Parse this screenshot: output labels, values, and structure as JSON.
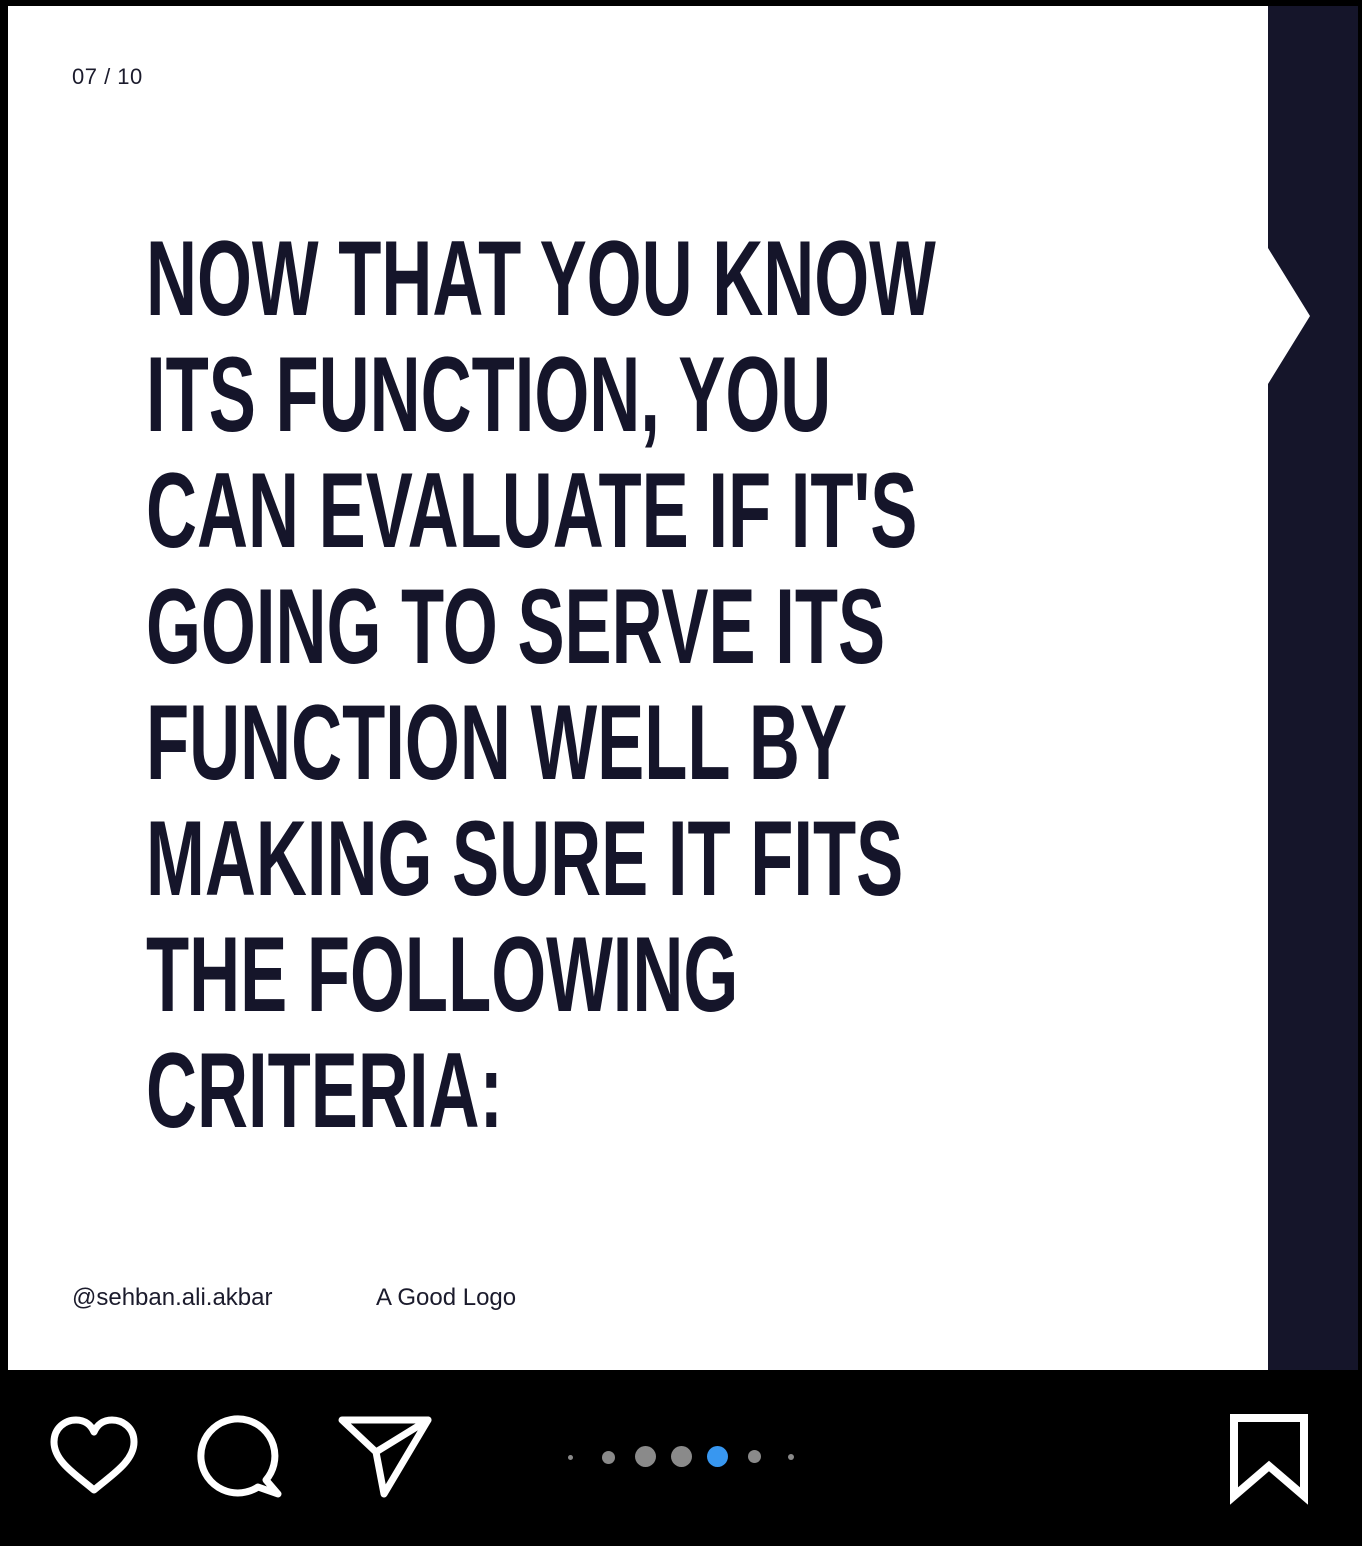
{
  "post": {
    "counter": "07 / 10",
    "headline_lines": [
      "NOW THAT YOU KNOW",
      "ITS FUNCTION, YOU",
      "CAN EVALUATE IF IT'S",
      "GOING TO SERVE ITS",
      "FUNCTION WELL BY",
      "MAKING SURE IT FITS",
      "THE FOLLOWING",
      "CRITERIA:"
    ],
    "handle": "@sehban.ali.akbar",
    "brand": "A Good Logo"
  },
  "colors": {
    "background": "#000000",
    "card": "#ffffff",
    "headline": "#15152a",
    "side_band": "#15152a",
    "active_dot": "#3897f0",
    "inactive_dot": "#8a8a8a"
  },
  "action_bar": {
    "icons": [
      "heart-icon",
      "comment-icon",
      "send-icon",
      "bookmark-icon"
    ],
    "carousel": {
      "active_index": 4
    }
  }
}
